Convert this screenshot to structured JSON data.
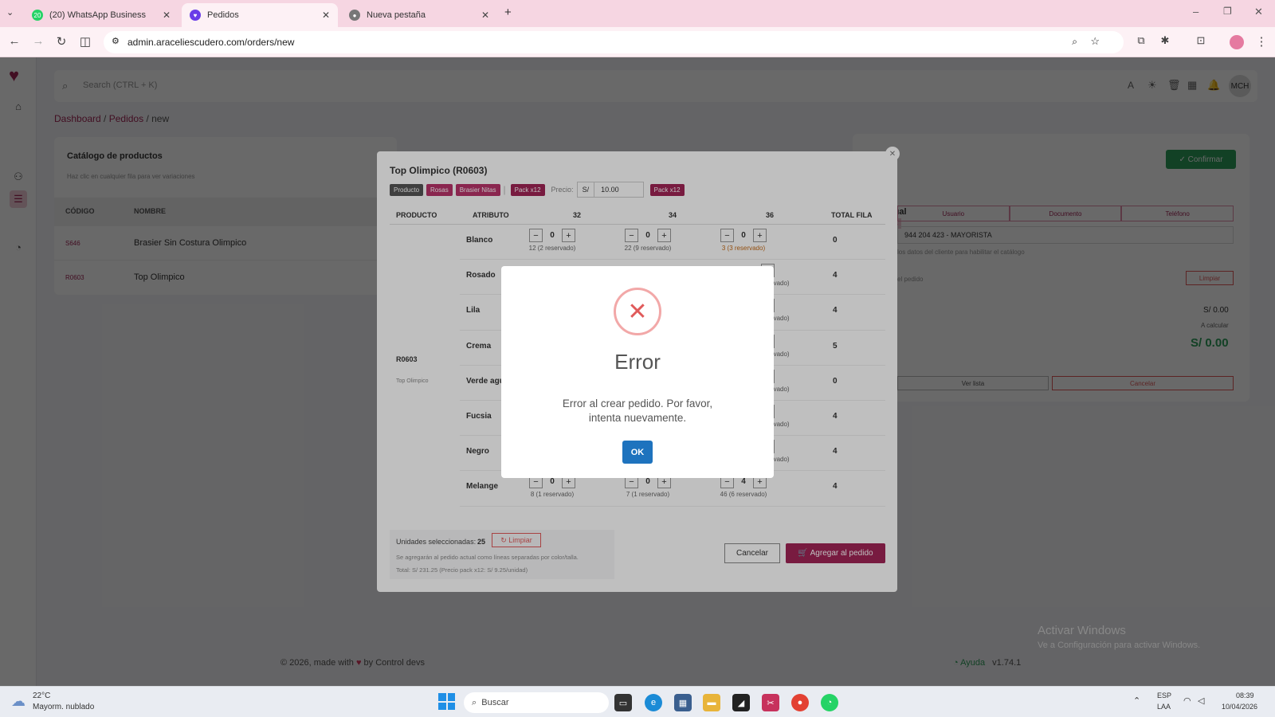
{
  "browser": {
    "tabs": [
      {
        "label": "(20) WhatsApp Business",
        "badge": "20"
      },
      {
        "label": "Pedidos"
      },
      {
        "label": "Nueva pestaña"
      }
    ],
    "url": "admin.araceliescudero.com/orders/new"
  },
  "app": {
    "search_placeholder": "Search (CTRL + K)",
    "avatar": "MCH",
    "breadcrumb": {
      "dashboard": "Dashboard",
      "pedidos": "Pedidos",
      "current": "new"
    },
    "catalog": {
      "title": "Catálogo de productos",
      "hint": "Haz clic en cualquier fila para ver variaciones",
      "col_code": "CÓDIGO",
      "col_name": "NOMBRE",
      "rows": [
        {
          "code": "S646",
          "name": "Brasier Sin Costura Olimpico"
        },
        {
          "code": "R0603",
          "name": "Top Olimpico"
        }
      ]
    },
    "right": {
      "title_fragment": "tual",
      "tag_fragment": "ms",
      "confirm": "Confirmar",
      "tab_user": "Usuario",
      "tab_doc": "Documento",
      "tab_phone": "Teléfono",
      "client": "944 204 423 - MAYORISTA",
      "client_hint": "los datos del cliente para habilitar el catálogo",
      "order_label": "el pedido",
      "clear": "Limpiar",
      "subtotal": "S/ 0.00",
      "shipping": "A calcular",
      "total": "S/ 0.00",
      "view_list": "Ver lista",
      "cancel": "Cancelar"
    },
    "footer": {
      "copyright": "© 2026, made with",
      "by": "by Control devs",
      "help": "Ayuda",
      "version": "v1.74.1"
    },
    "windows_watermark": {
      "title": "Activar Windows",
      "subtitle": "Ve a Configuración para activar Windows."
    }
  },
  "product_modal": {
    "title": "Top Olimpico (R0603)",
    "badges": [
      "Producto",
      "Rosas",
      "Brasier Nitas",
      "Pack x12"
    ],
    "price_label": "Precio:",
    "currency": "S/",
    "price": "10.00",
    "pack_badge": "Pack x12",
    "headers": [
      "PRODUCTO",
      "ATRIBUTO",
      "32",
      "34",
      "36",
      "TOTAL FILA"
    ],
    "product_code": "R0603",
    "product_name": "Top Olimpico",
    "rows": [
      {
        "attr": "Blanco",
        "total": "0",
        "v": [
          "0",
          "0",
          "0"
        ],
        "stock": [
          "12 (2 reservado)",
          "22 (9 reservado)",
          "3 (3 reservado)"
        ]
      },
      {
        "attr": "Rosado",
        "total": "4",
        "stock36": "eservado)"
      },
      {
        "attr": "Lila",
        "total": "4",
        "stock36": "eservado)"
      },
      {
        "attr": "Crema",
        "total": "5",
        "stock36": "eservado)"
      },
      {
        "attr": "Verde agu",
        "total": "0",
        "stock36": "eservado)"
      },
      {
        "attr": "Fucsia",
        "total": "4",
        "stock36": "eservado)"
      },
      {
        "attr": "Negro",
        "total": "4",
        "stock36": "eservado)"
      },
      {
        "attr": "Melange",
        "total": "4",
        "v": [
          "0",
          "0",
          "4"
        ],
        "stock": [
          "8 (1 reservado)",
          "7 (1 reservado)",
          "46 (6 reservado)"
        ]
      }
    ],
    "units_label": "Unidades seleccionadas:",
    "units": "25",
    "clear": "Limpiar",
    "note": "Se agregarán al pedido actual como líneas separadas por color/talla.",
    "total_line": "Total: S/ 231.25 (Precio pack x12: S/ 9.25/unidad)",
    "cancel": "Cancelar",
    "add": "Agregar al pedido"
  },
  "error_dialog": {
    "title": "Error",
    "message": "Error al crear pedido. Por favor, intenta nuevamente.",
    "ok": "OK"
  },
  "taskbar": {
    "weather_temp": "22°C",
    "weather_desc": "Mayorm. nublado",
    "search": "Buscar",
    "lang": "ESP",
    "region": "LAA",
    "time": "08:39",
    "date": "10/04/2026"
  },
  "colors": {
    "brand": "#a02556",
    "confirm": "#2e9e5b",
    "ok_button": "#1e73be",
    "error": "#e05a5a"
  }
}
